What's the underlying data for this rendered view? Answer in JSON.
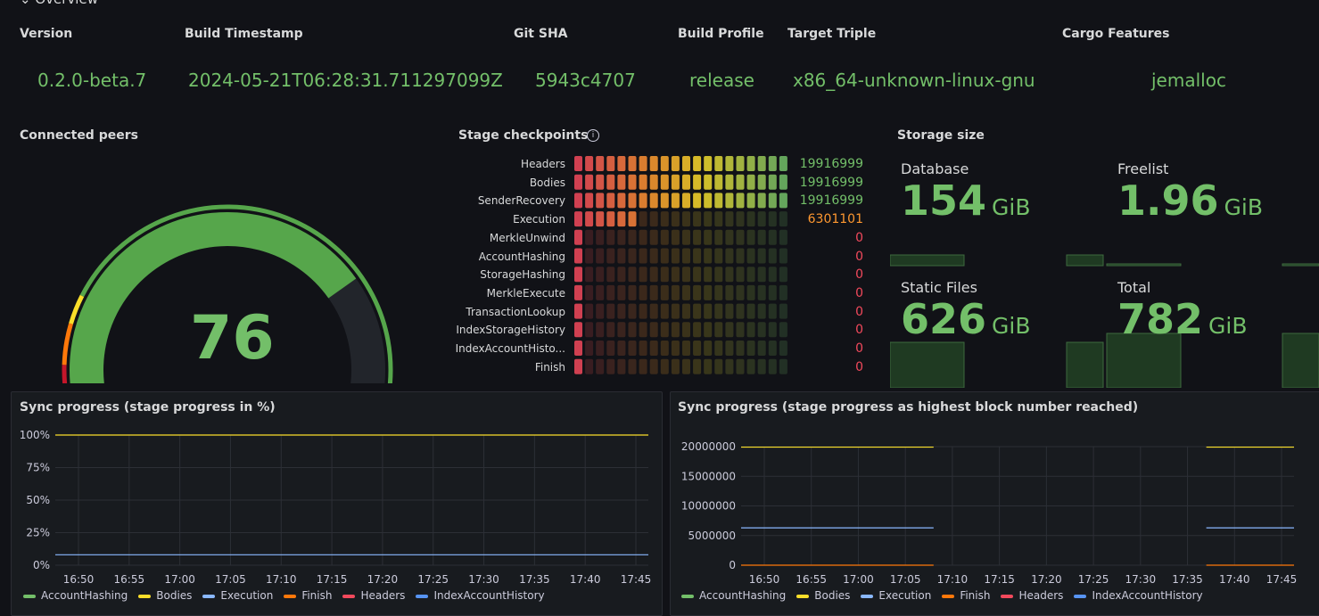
{
  "overview": {
    "section_label": "Overview",
    "columns": [
      {
        "header": "Version",
        "value": "0.2.0-beta.7"
      },
      {
        "header": "Build Timestamp",
        "value": "2024-05-21T06:28:31.711297099Z"
      },
      {
        "header": "Git SHA",
        "value": "5943c4707"
      },
      {
        "header": "Build Profile",
        "value": "release"
      },
      {
        "header": "Target Triple",
        "value": "x86_64-unknown-linux-gnu"
      },
      {
        "header": "Cargo Features",
        "value": "jemalloc"
      }
    ]
  },
  "peers": {
    "title": "Connected peers",
    "value": "76",
    "gauge_fraction": 0.76
  },
  "checkpoints": {
    "title": "Stage checkpoints",
    "info_icon": "info-circle-icon",
    "stages": [
      {
        "label": "Headers",
        "value": "19916999",
        "fraction": 1.0,
        "color": "#73bf69"
      },
      {
        "label": "Bodies",
        "value": "19916999",
        "fraction": 1.0,
        "color": "#73bf69"
      },
      {
        "label": "SenderRecovery",
        "value": "19916999",
        "fraction": 1.0,
        "color": "#73bf69"
      },
      {
        "label": "Execution",
        "value": "6301101",
        "fraction": 0.32,
        "color": "#ff9830"
      },
      {
        "label": "MerkleUnwind",
        "value": "0",
        "fraction": 0,
        "color": "#f2495c"
      },
      {
        "label": "AccountHashing",
        "value": "0",
        "fraction": 0,
        "color": "#f2495c"
      },
      {
        "label": "StorageHashing",
        "value": "0",
        "fraction": 0,
        "color": "#f2495c"
      },
      {
        "label": "MerkleExecute",
        "value": "0",
        "fraction": 0,
        "color": "#f2495c"
      },
      {
        "label": "TransactionLookup",
        "value": "0",
        "fraction": 0,
        "color": "#f2495c"
      },
      {
        "label": "IndexStorageHistory",
        "value": "0",
        "fraction": 0,
        "color": "#f2495c"
      },
      {
        "label": "IndexAccountHisto...",
        "value": "0",
        "fraction": 0,
        "color": "#f2495c"
      },
      {
        "label": "Finish",
        "value": "0",
        "fraction": 0,
        "color": "#f2495c"
      }
    ]
  },
  "storage": {
    "title": "Storage size",
    "tiles": [
      {
        "label": "Database",
        "number": "154",
        "unit": "GiB"
      },
      {
        "label": "Freelist",
        "number": "1.96",
        "unit": "GiB"
      },
      {
        "label": "Static Files",
        "number": "626",
        "unit": "GiB"
      },
      {
        "label": "Total",
        "number": "782",
        "unit": "GiB"
      }
    ]
  },
  "sync_pct": {
    "title": "Sync progress (stage progress in %)",
    "chart_data": {
      "type": "line",
      "title": "Sync progress (stage progress in %)",
      "x": [
        "16:50",
        "16:55",
        "17:00",
        "17:05",
        "17:10",
        "17:15",
        "17:20",
        "17:25",
        "17:30",
        "17:35",
        "17:40",
        "17:45"
      ],
      "y_ticks": [
        "0%",
        "25%",
        "50%",
        "75%",
        "100%"
      ],
      "ylim": [
        0,
        100
      ],
      "series": [
        {
          "name": "Bodies",
          "color": "#fade2a",
          "value": 100
        },
        {
          "name": "Execution",
          "color": "#8ab8ff",
          "value": 8
        }
      ]
    },
    "legend": [
      {
        "name": "AccountHashing",
        "color": "#73bf69"
      },
      {
        "name": "Bodies",
        "color": "#fade2a"
      },
      {
        "name": "Execution",
        "color": "#8ab8ff"
      },
      {
        "name": "Finish",
        "color": "#ff780a"
      },
      {
        "name": "Headers",
        "color": "#f2495c"
      },
      {
        "name": "IndexAccountHistory",
        "color": "#5794f2"
      }
    ]
  },
  "sync_block": {
    "title": "Sync progress (stage progress as highest block number reached)",
    "chart_data": {
      "type": "line",
      "title": "Sync progress (stage progress as highest block number reached)",
      "x": [
        "16:50",
        "16:55",
        "17:00",
        "17:05",
        "17:10",
        "17:15",
        "17:20",
        "17:25",
        "17:30",
        "17:35",
        "17:40",
        "17:45"
      ],
      "y_ticks": [
        "0",
        "5000000",
        "10000000",
        "15000000",
        "20000000"
      ],
      "ylim": [
        0,
        22000000
      ],
      "series": [
        {
          "name": "Bodies",
          "color": "#fade2a",
          "value": 19916999,
          "segments": [
            [
              "16:47",
              "17:08"
            ],
            [
              "17:37",
              "17:48"
            ]
          ]
        },
        {
          "name": "Execution",
          "color": "#8ab8ff",
          "value": 6301101,
          "segments": [
            [
              "16:47",
              "17:08"
            ],
            [
              "17:37",
              "17:48"
            ]
          ]
        },
        {
          "name": "Finish",
          "color": "#ff780a",
          "value": 0,
          "segments": [
            [
              "16:47",
              "17:08"
            ],
            [
              "17:37",
              "17:48"
            ]
          ]
        }
      ]
    },
    "legend": [
      {
        "name": "AccountHashing",
        "color": "#73bf69"
      },
      {
        "name": "Bodies",
        "color": "#fade2a"
      },
      {
        "name": "Execution",
        "color": "#8ab8ff"
      },
      {
        "name": "Finish",
        "color": "#ff780a"
      },
      {
        "name": "Headers",
        "color": "#f2495c"
      },
      {
        "name": "IndexAccountHistory",
        "color": "#5794f2"
      }
    ]
  }
}
